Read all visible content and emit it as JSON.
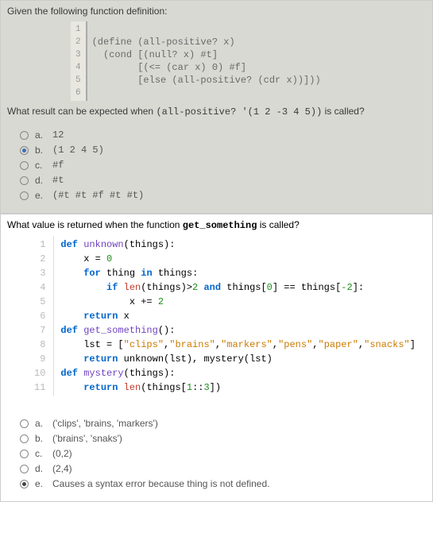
{
  "q1": {
    "prompt": "Given the following function definition:",
    "code_lines": {
      "l1": "",
      "l2": "(define (all-positive? x)",
      "l3": "  (cond [(null? x) #t]",
      "l4": "        [(<= (car x) 0) #f]",
      "l5": "        [else (all-positive? (cdr x))]))",
      "l6": ""
    },
    "result_prefix": "What result can be expected when ",
    "result_code": "(all-positive? '(1 2 -3 4 5))",
    "result_suffix": " is called?",
    "options": [
      {
        "letter": "a.",
        "text": "12",
        "selected": false
      },
      {
        "letter": "b.",
        "text": "(1 2 4 5)",
        "selected": true
      },
      {
        "letter": "c.",
        "text": "#f",
        "selected": false
      },
      {
        "letter": "d.",
        "text": "#t",
        "selected": false
      },
      {
        "letter": "e.",
        "text": "(#t #t #f #t #t)",
        "selected": false
      }
    ]
  },
  "q2": {
    "prompt_prefix": "What value is returned when the function ",
    "prompt_fn": "get_something",
    "prompt_suffix": " is called?",
    "line_nums": [
      "1",
      "2",
      "3",
      "4",
      "5",
      "6",
      "7",
      "8",
      "9",
      "10",
      "11"
    ],
    "options": [
      {
        "letter": "a.",
        "text": "('clips', 'brains, 'markers')",
        "selected": false
      },
      {
        "letter": "b.",
        "text": "('brains', 'snaks')",
        "selected": false
      },
      {
        "letter": "c.",
        "text": "(0,2)",
        "selected": false
      },
      {
        "letter": "d.",
        "text": "(2,4)",
        "selected": false
      },
      {
        "letter": "e.",
        "text": "Causes a syntax error because thing is not defined.",
        "selected": true
      }
    ]
  }
}
